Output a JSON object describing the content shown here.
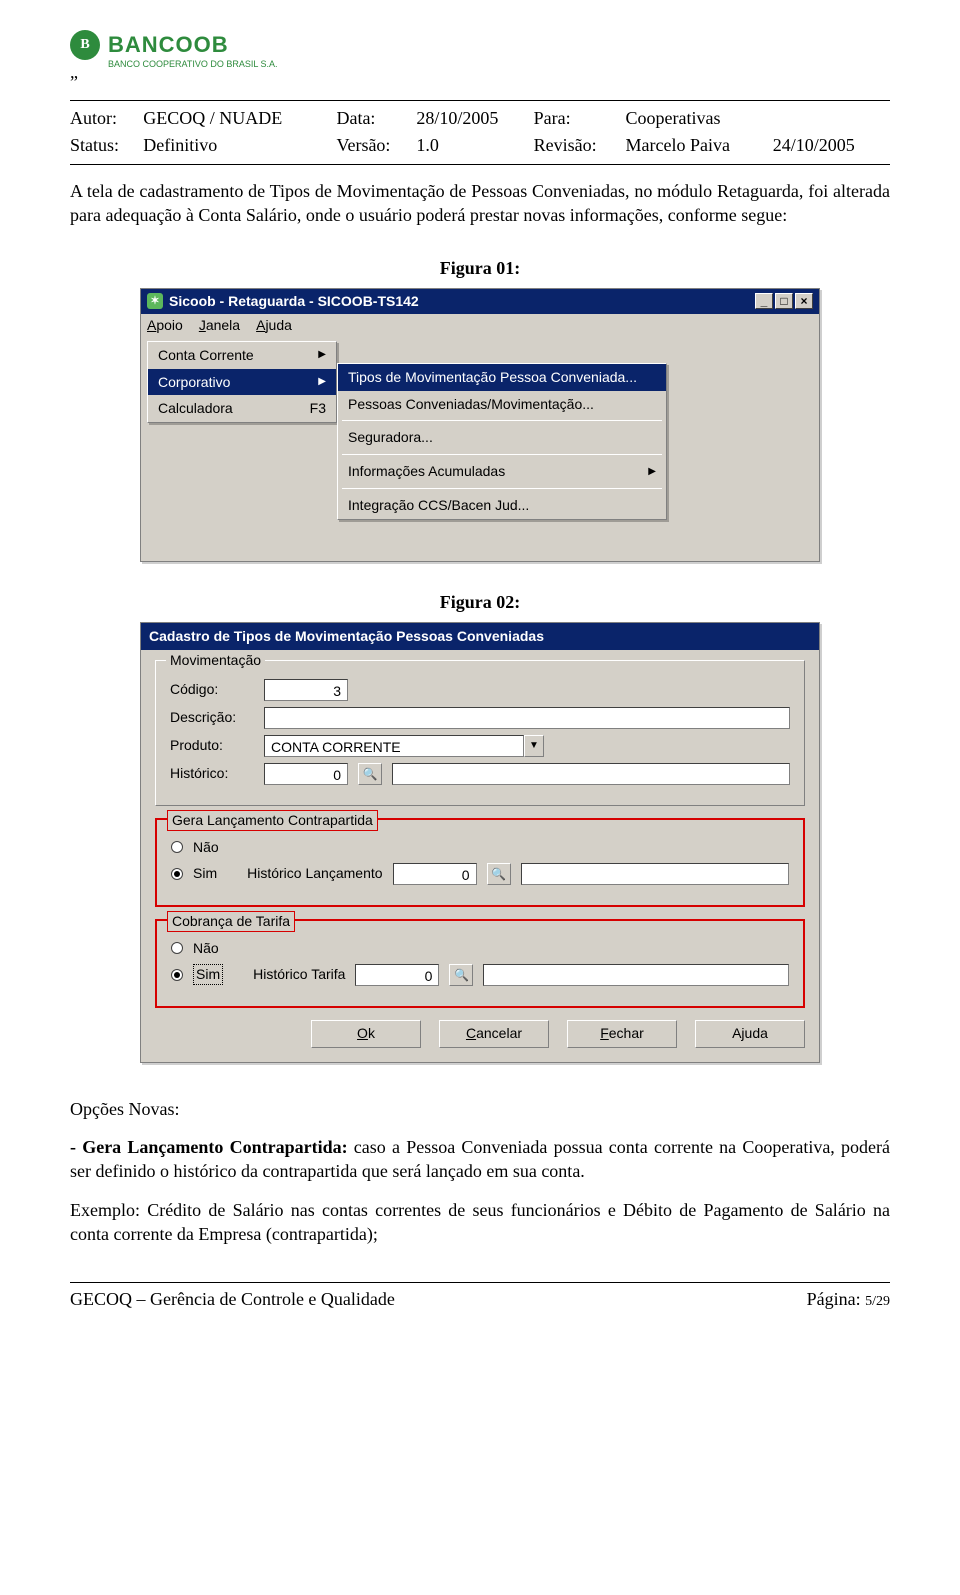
{
  "header": {
    "logo_badge": "B",
    "logo_text": "BANCOOB",
    "logo_sub": "BANCO COOPERATIVO DO BRASIL S.A.",
    "dblq": "”"
  },
  "meta": {
    "autor_lbl": "Autor:",
    "autor": "GECOQ / NUADE",
    "data_lbl": "Data:",
    "data": "28/10/2005",
    "para_lbl": "Para:",
    "para": "Cooperativas",
    "status_lbl": "Status:",
    "status": "Definitivo",
    "versao_lbl": "Versão:",
    "versao": "1.0",
    "revisao_lbl": "Revisão:",
    "revisao": "Marcelo Paiva",
    "rev_data": "24/10/2005"
  },
  "para1": "A tela de cadastramento de Tipos de Movimentação de Pessoas Conveniadas, no módulo Retaguarda, foi alterada para adequação à Conta Salário, onde o usuário poderá prestar novas informações, conforme segue:",
  "fig1_label": "Figura 01:",
  "fig2_label": "Figura 02:",
  "fig1": {
    "title": "Sicoob - Retaguarda - SICOOB-TS142",
    "menubar": {
      "apoio": "Apoio",
      "janela": "Janela",
      "ajuda": "Ajuda"
    },
    "menu1": [
      {
        "label": "Conta Corrente",
        "shortcut": "",
        "arrow": true,
        "sel": false
      },
      {
        "label": "Corporativo",
        "shortcut": "",
        "arrow": true,
        "sel": true
      },
      {
        "label": "Calculadora",
        "shortcut": "F3",
        "arrow": false,
        "sel": false
      }
    ],
    "menu2": [
      {
        "label": "Tipos de Movimentação Pessoa Conveniada...",
        "arrow": false,
        "sel": true
      },
      {
        "label": "Pessoas Conveniadas/Movimentação...",
        "arrow": false
      },
      {
        "div": true
      },
      {
        "label": "Seguradora...",
        "arrow": false
      },
      {
        "div": true
      },
      {
        "label": "Informações Acumuladas",
        "arrow": true
      },
      {
        "div": true
      },
      {
        "label": "Integração CCS/Bacen Jud...",
        "arrow": false
      }
    ]
  },
  "fig2": {
    "title": "Cadastro de Tipos de Movimentação Pessoas Conveniadas",
    "group_mov": "Movimentação",
    "codigo_lbl": "Código:",
    "codigo_val": "3",
    "descricao_lbl": "Descrição:",
    "descricao_val": "",
    "produto_lbl": "Produto:",
    "produto_val": "CONTA CORRENTE",
    "historico_lbl": "Histórico:",
    "historico_val": "0",
    "group_contra": "Gera Lançamento Contrapartida",
    "nao": "Não",
    "sim": "Sim",
    "hist_lanc_lbl": "Histórico Lançamento",
    "hist_lanc_val": "0",
    "group_tarifa": "Cobrança de Tarifa",
    "hist_tarifa_lbl": "Histórico Tarifa",
    "hist_tarifa_val": "0",
    "buttons": {
      "ok": "Ok",
      "cancelar": "Cancelar",
      "fechar": "Fechar",
      "ajuda": "Ajuda"
    }
  },
  "opcoes_title": "Opções Novas:",
  "opcoes_item_bold": "- Gera Lançamento Contrapartida:",
  "opcoes_item_rest": " caso a Pessoa Conveniada possua conta corrente na Cooperativa, poderá ser definido o histórico da contrapartida que será lançado em sua conta.",
  "opcoes_ex": "Exemplo: Crédito de Salário nas contas correntes de seus funcionários e Débito de Pagamento de Salário na conta corrente da Empresa (contrapartida);",
  "footer": {
    "left": "GECOQ – Gerência de Controle e Qualidade",
    "right_lbl": "Página: ",
    "right_val": "5/29"
  }
}
